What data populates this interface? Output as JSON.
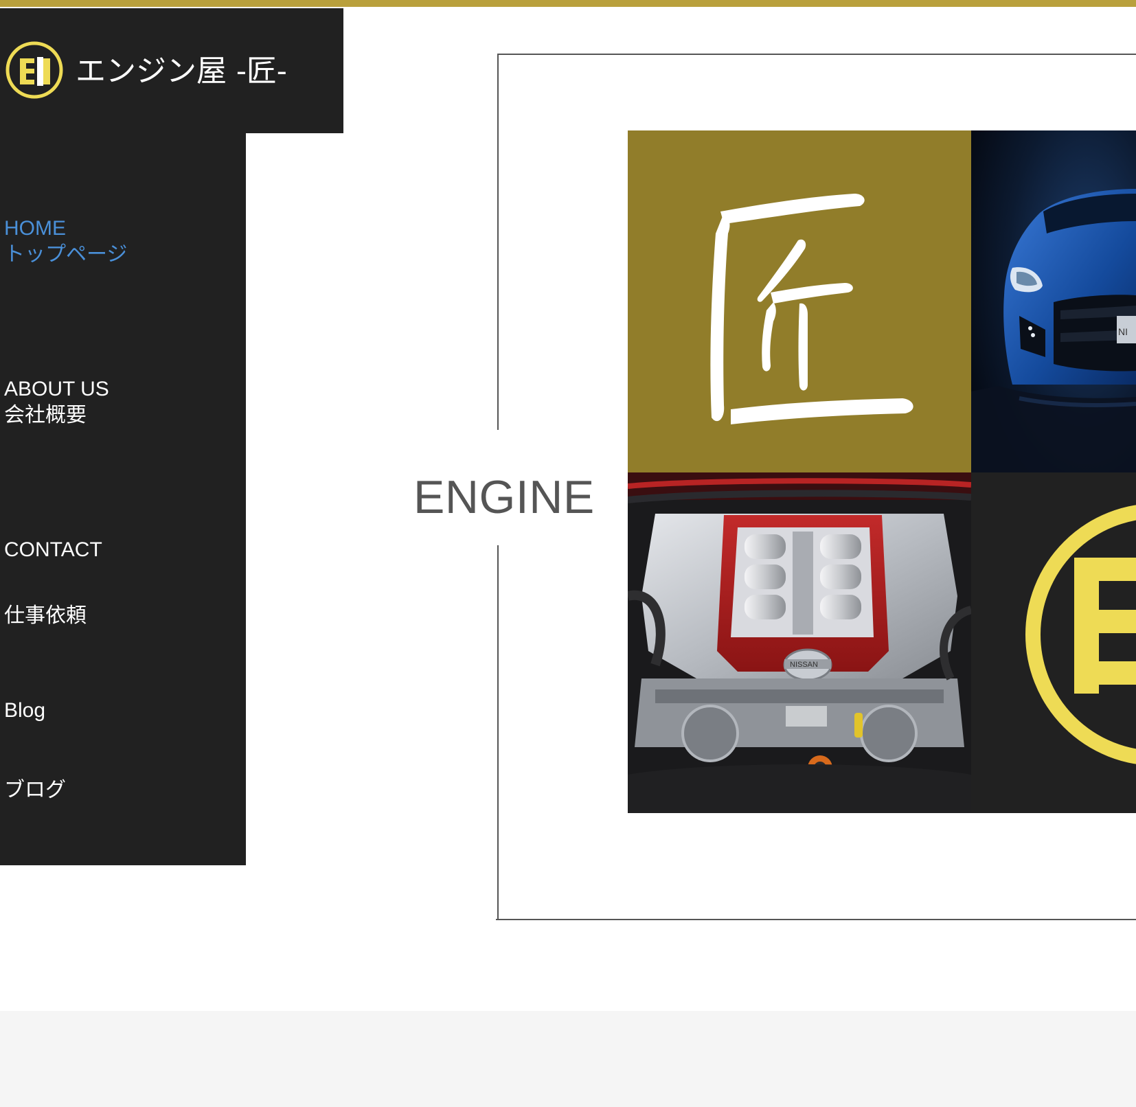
{
  "brand": {
    "name": "エンジン屋 -匠-",
    "logo_icon": "engine-ya-logo-icon",
    "colors": {
      "gold": "#b9a03c",
      "logo_yellow": "#eedb55",
      "dark": "#212121",
      "olive": "#917d2a",
      "active_link": "#4a90d9"
    }
  },
  "nav": {
    "items": [
      {
        "en": "HOME",
        "ja": "トップページ",
        "active": true
      },
      {
        "en": "ABOUT US",
        "ja": "会社概要",
        "active": false
      },
      {
        "en": "CONTACT",
        "ja": "仕事依頼",
        "active": false
      },
      {
        "en": "Blog",
        "ja": "ブログ",
        "active": false
      }
    ]
  },
  "hero": {
    "title": "ENGINE",
    "tiles": [
      {
        "name": "takumi-kanji-tile",
        "text": "匠"
      },
      {
        "name": "blue-sports-car-tile",
        "badge": "NI"
      },
      {
        "name": "engine-bay-tile",
        "badge": "NISSAN"
      },
      {
        "name": "logo-mark-tile"
      }
    ]
  }
}
